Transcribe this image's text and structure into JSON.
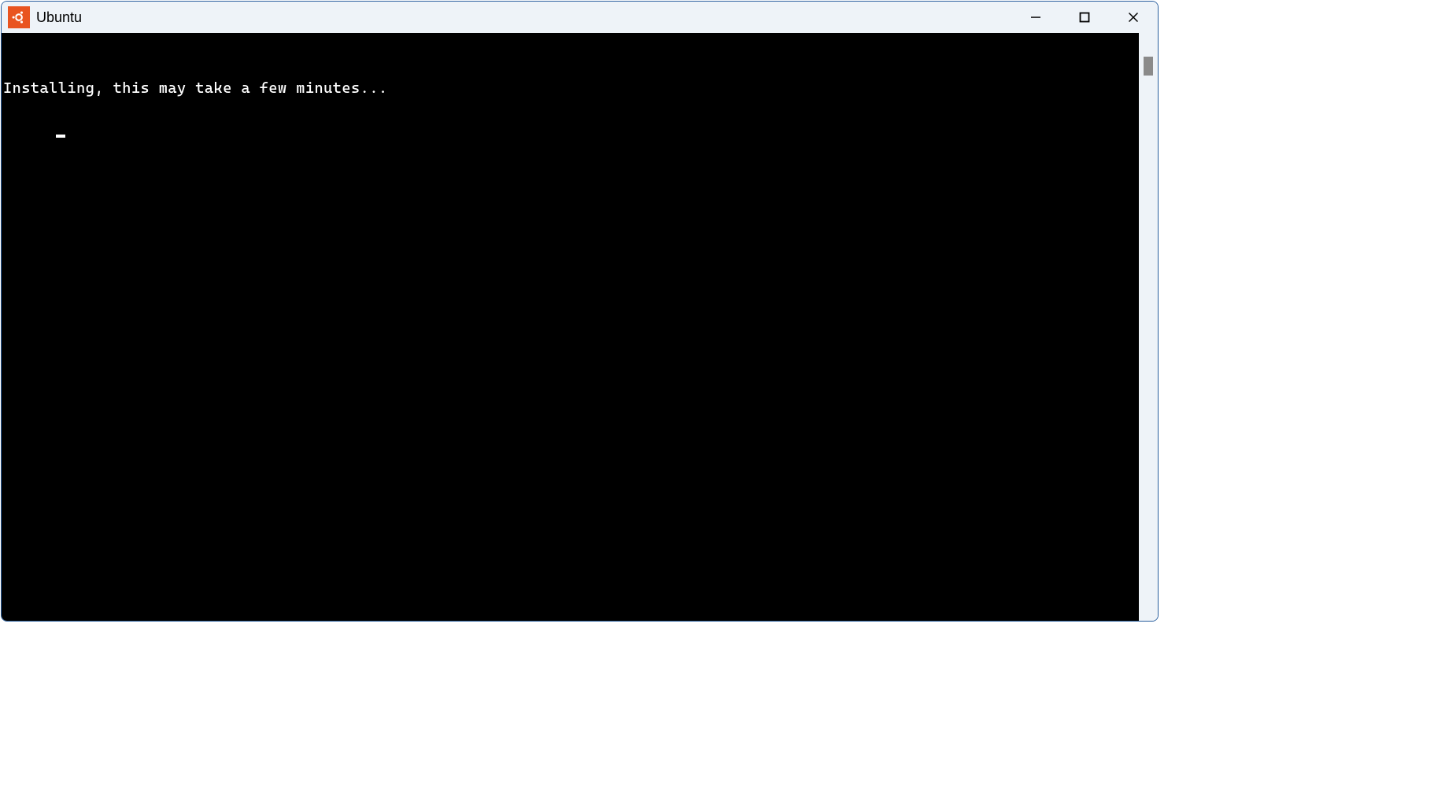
{
  "window": {
    "title": "Ubuntu",
    "icon": "ubuntu-icon"
  },
  "terminal": {
    "lines": [
      "Installing, this may take a few minutes..."
    ]
  },
  "colors": {
    "ubuntu_orange": "#E95420",
    "terminal_bg": "#000000",
    "terminal_fg": "#ffffff",
    "titlebar_bg": "#eef3f8"
  }
}
